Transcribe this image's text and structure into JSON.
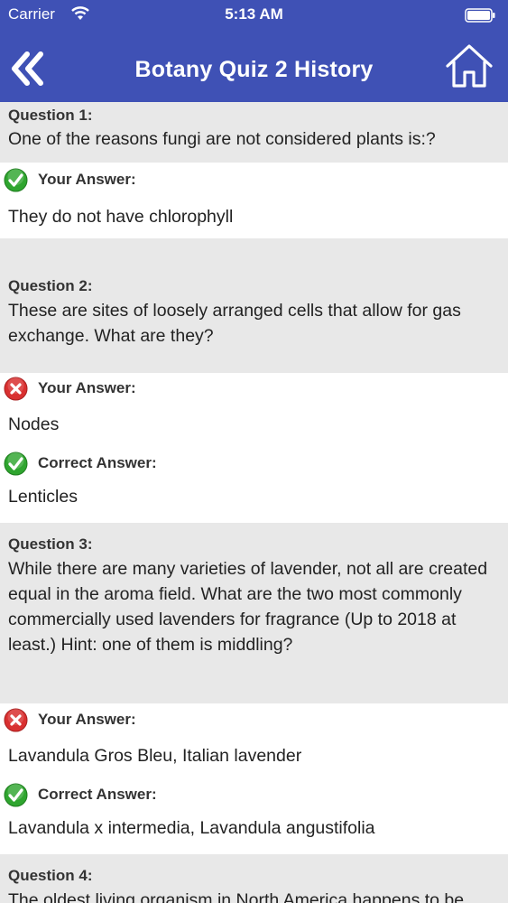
{
  "status_bar": {
    "carrier": "Carrier",
    "time": "5:13 AM",
    "wifi_icon": "wifi-icon",
    "battery_icon": "battery-icon"
  },
  "header": {
    "title": "Botany Quiz 2 History",
    "back_icon": "double-chevron-left-icon",
    "home_icon": "home-icon",
    "background_color": "#3f51b5"
  },
  "colors": {
    "question_background": "#e8e8e8",
    "correct_icon": "#2fa52f",
    "wrong_icon": "#d93030"
  },
  "questions": [
    {
      "label": "Question 1:",
      "text": "One of the reasons fungi are not considered plants is:?",
      "your_answer_label": "Your Answer:",
      "your_answer": "They do not have chlorophyll",
      "your_answer_icon": "check-circle-icon"
    },
    {
      "label": "Question 2:",
      "text": "These are sites of loosely arranged cells that allow for gas exchange. What are they?",
      "your_answer_label": "Your Answer:",
      "your_answer": "Nodes",
      "your_answer_icon": "x-circle-icon",
      "correct_answer_label": "Correct Answer:",
      "correct_answer": "Lenticles",
      "correct_answer_icon": "check-circle-icon"
    },
    {
      "label": "Question 3:",
      "text": "While there are many varieties of lavender, not all are created equal in the aroma field. What are the two most commonly commercially used lavenders for fragrance (Up to 2018 at least.) Hint: one of them is middling?",
      "your_answer_label": "Your Answer:",
      "your_answer": "Lavandula Gros Bleu, Italian lavender",
      "your_answer_icon": "x-circle-icon",
      "correct_answer_label": "Correct Answer:",
      "correct_answer": "Lavandula x intermedia, Lavandula angustifolia",
      "correct_answer_icon": "check-circle-icon"
    },
    {
      "label": "Question 4:",
      "text": "The oldest living organism in North America happens to be"
    }
  ]
}
